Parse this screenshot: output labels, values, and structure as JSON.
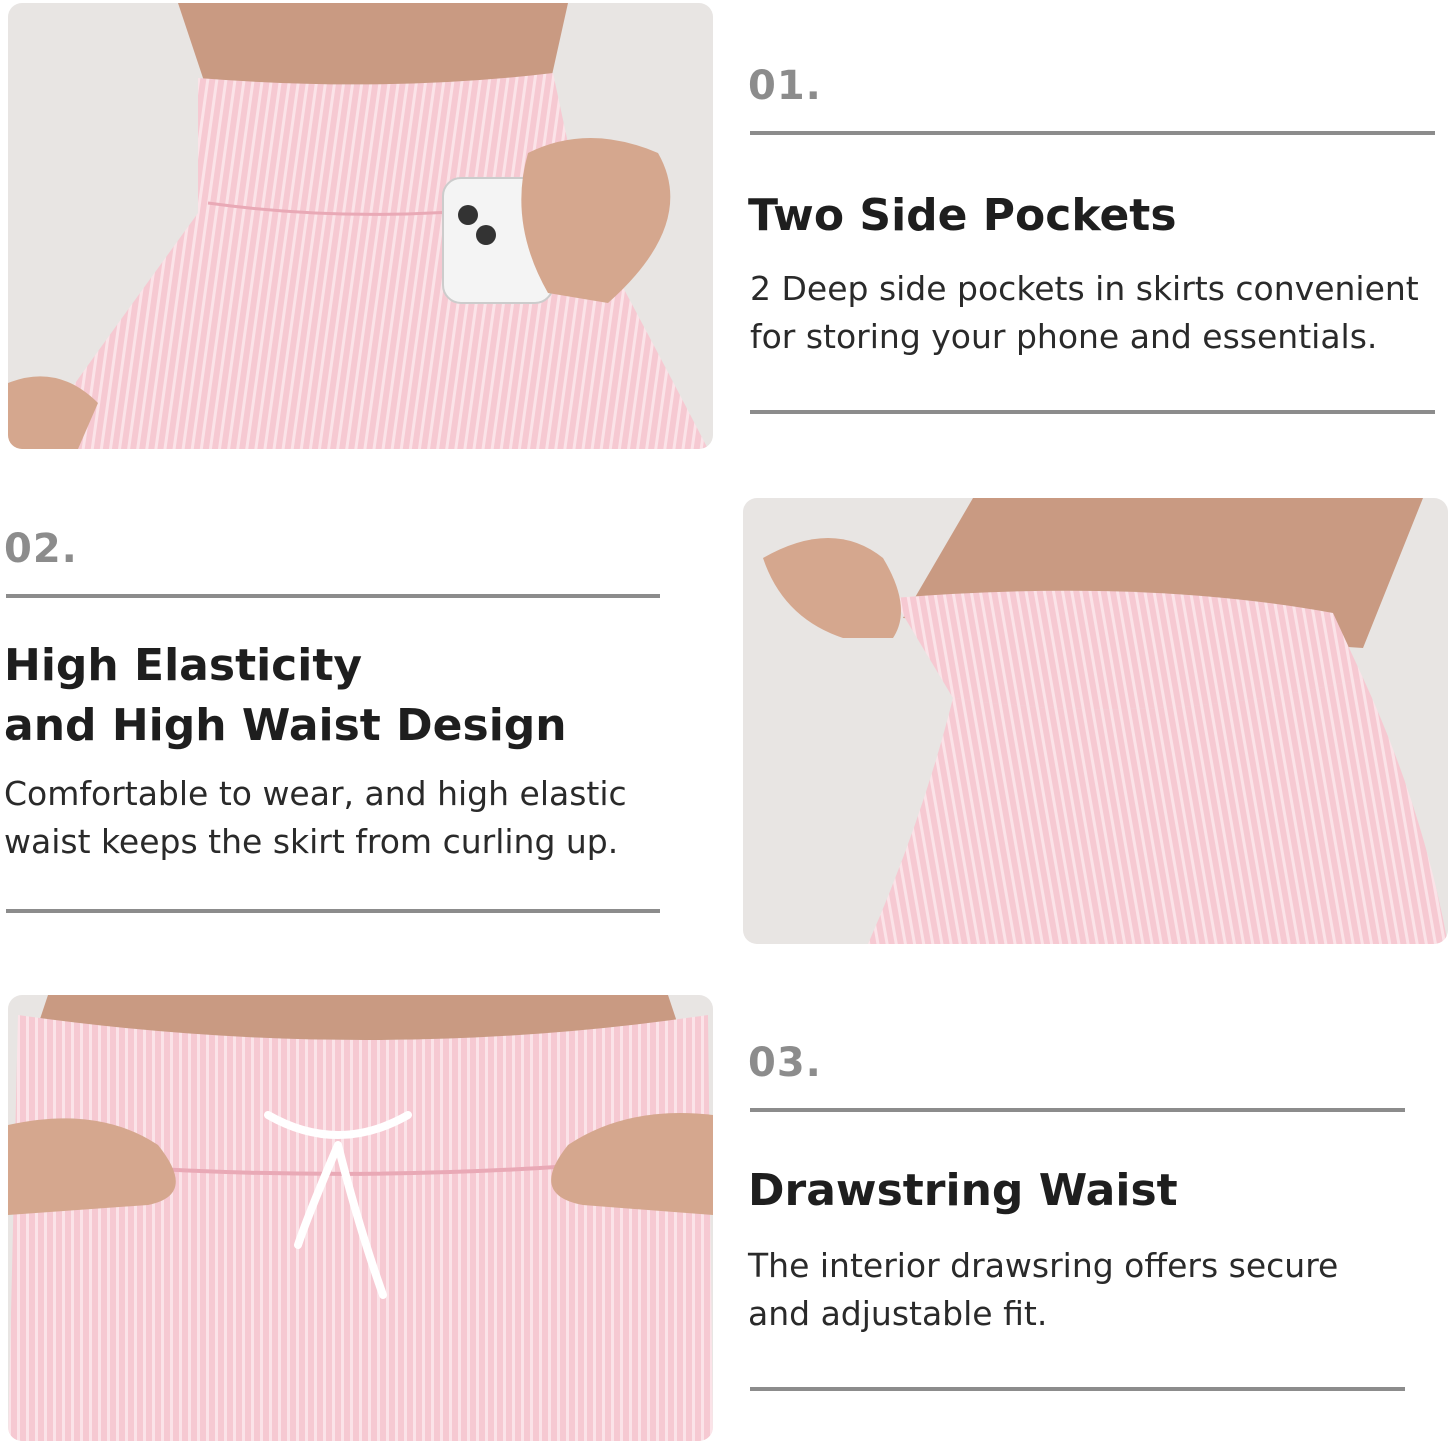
{
  "sections": [
    {
      "number": "01.",
      "title_lines": [
        "Two Side Pockets"
      ],
      "description_lines": [
        "2 Deep side pockets in skirts convenient",
        "for storing your phone and essentials."
      ]
    },
    {
      "number": "02.",
      "title_lines": [
        "High Elasticity",
        "and High Waist Design"
      ],
      "description_lines": [
        "Comfortable to wear, and high elastic",
        "waist keeps the skirt from curling up."
      ]
    },
    {
      "number": "03.",
      "title_lines": [
        "Drawstring Waist"
      ],
      "description_lines": [
        "The interior drawsring offers secure",
        "and adjustable fit."
      ]
    }
  ],
  "colors": {
    "number": "#8c8c8c",
    "rule": "#8c8c8c",
    "title": "#1e1e1e",
    "skirt_pink": "#f6c9d2",
    "photo_background": "#e8e5e3"
  }
}
